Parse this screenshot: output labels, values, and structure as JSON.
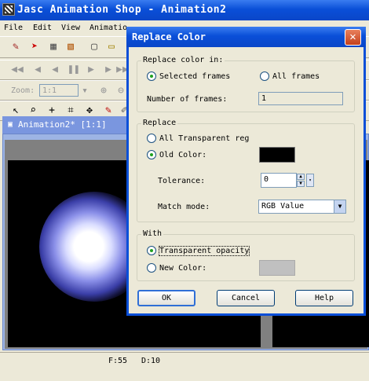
{
  "app": {
    "title": "Jasc Animation Shop - Animation2",
    "menu": [
      "File",
      "Edit",
      "View",
      "Animatio"
    ],
    "zoom_label": "Zoom:",
    "zoom_value": "1:1",
    "doc_title": "Animation2* [1:1]"
  },
  "status": {
    "frame": "F:55",
    "delay": "D:10"
  },
  "dialog": {
    "title": "Replace Color",
    "close": "✕",
    "replace_in": {
      "legend": "Replace color in:",
      "selected_frames": "Selected frames",
      "all_frames": "All frames",
      "num_frames_label": "Number of frames:",
      "num_frames_value": "1"
    },
    "replace": {
      "legend": "Replace",
      "all_transparent": "All Transparent reg",
      "old_color": "Old Color:",
      "old_color_value": "#000000",
      "tolerance_label": "Tolerance:",
      "tolerance_value": "0",
      "match_mode_label": "Match mode:",
      "match_mode_value": "RGB Value"
    },
    "with": {
      "legend": "With",
      "transparent_opacity": "Transparent opacity",
      "new_color": "New Color:",
      "new_color_value": "#c0c0c0"
    },
    "buttons": {
      "ok": "OK",
      "cancel": "Cancel",
      "help": "Help"
    }
  },
  "colors": {
    "titlebar": "#0a4fd8",
    "face": "#ece9d8"
  }
}
